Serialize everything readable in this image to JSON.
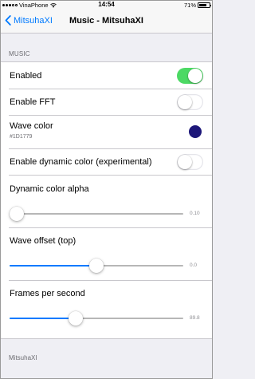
{
  "status_bar": {
    "carrier": "VinaPhone",
    "time": "14:54",
    "battery": "71%",
    "battery_fraction": 0.71
  },
  "nav": {
    "back_label": "MitsuhaXI",
    "title": "Music - MitsuhaXI"
  },
  "section": {
    "header": "MUSIC",
    "footer": "MitsuhaXI"
  },
  "settings": {
    "enabled": {
      "label": "Enabled",
      "on": true
    },
    "fft": {
      "label": "Enable FFT",
      "on": false
    },
    "wave_color": {
      "label": "Wave color",
      "value": "#1D1779",
      "swatch": "#1D1779"
    },
    "dynamic_color": {
      "label": "Enable dynamic color (experimental)",
      "on": false
    },
    "alpha": {
      "label": "Dynamic color alpha",
      "value_text": "0.10",
      "fraction": 0.0
    },
    "wave_offset": {
      "label": "Wave offset (top)",
      "value_text": "0.0",
      "fraction": 0.5
    },
    "fps": {
      "label": "Frames per second",
      "value_text": "89.8",
      "fraction": 0.37
    }
  },
  "colors": {
    "accent": "#007aff",
    "switch_on": "#4cd964",
    "background": "#efeff4"
  }
}
